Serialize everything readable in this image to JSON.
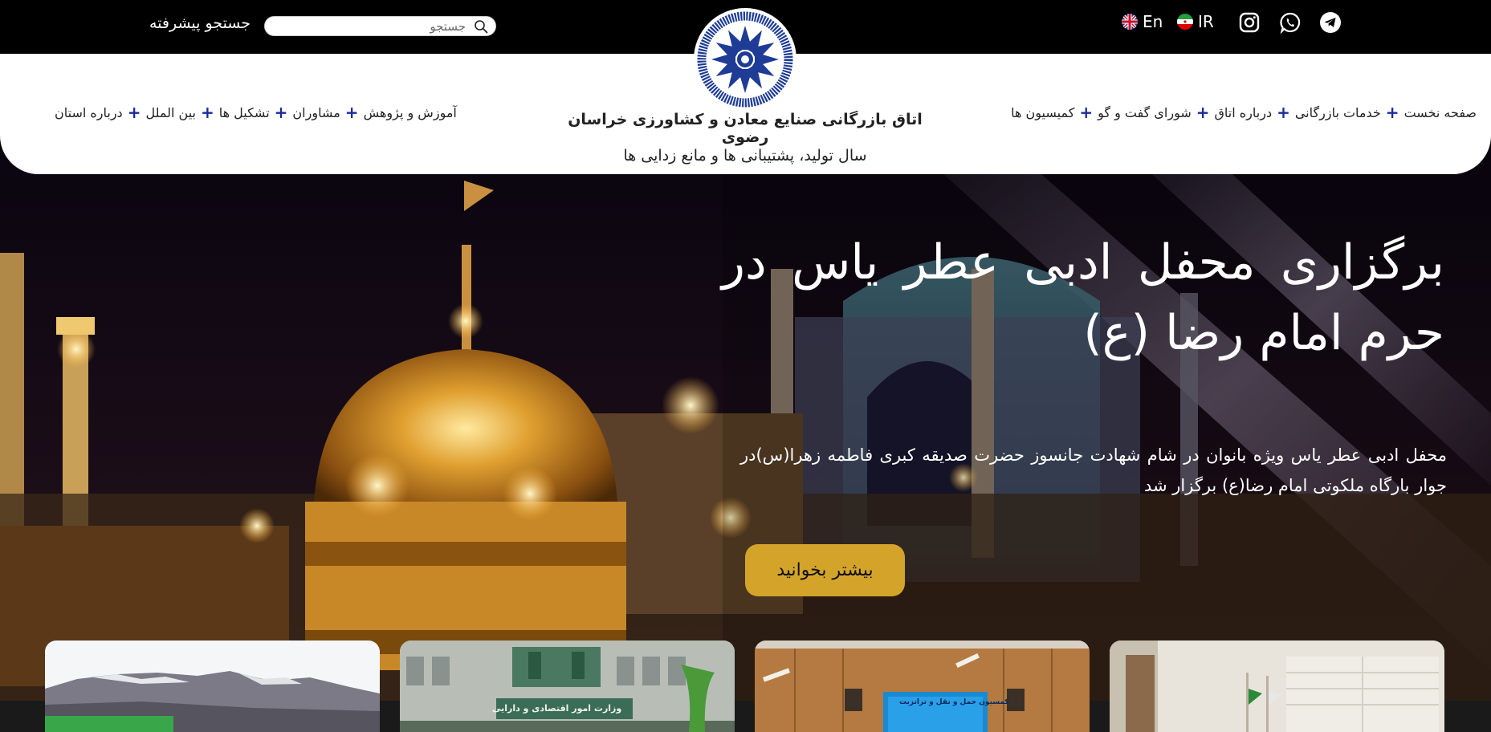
{
  "topbar": {
    "advanced_search_label": "جستجو پیشرفته",
    "search_placeholder": "جستجو",
    "languages": [
      {
        "code": "En",
        "flag": "uk-flag-icon"
      },
      {
        "code": "IR",
        "flag": "iran-flag-icon"
      }
    ],
    "social": [
      "instagram-icon",
      "whatsapp-icon",
      "telegram-icon"
    ]
  },
  "header": {
    "org_name": "اتاق بازرگانی صنایع معادن و کشاورزی خراسان رضوی",
    "slogan": "سال تولید، پشتیبانی ها و مانع زدایی ها",
    "nav_right": [
      "صفحه نخست",
      "خدمات بازرگانی",
      "درباره اتاق",
      "شورای گفت و گو",
      "کمیسیون ها"
    ],
    "nav_left": [
      "درباره استان",
      "بین الملل",
      "تشکیل ها",
      "مشاوران",
      "آموزش و پژوهش"
    ]
  },
  "hero": {
    "title": "برگزاری محفل ادبی عطر یاس در حرم امام رضا (ع)",
    "description": "محفل ادبی عطر یاس ویژه بانوان در شام شهادت جانسوز حضرت صدیقه کبری فاطمه زهرا(س)در جوار بارگاه ملکوتی امام رضا(ع) برگزار شد",
    "read_more": "بیشتر بخوانید"
  },
  "cards": {
    "card2_sign": "وزارت امور اقتصادی و دارایی",
    "card3_screen": "کمسیون حمل و نقل و ترانزیت"
  },
  "colors": {
    "accent_blue": "#1a2a9a",
    "button_gold": "#d4a42a"
  }
}
